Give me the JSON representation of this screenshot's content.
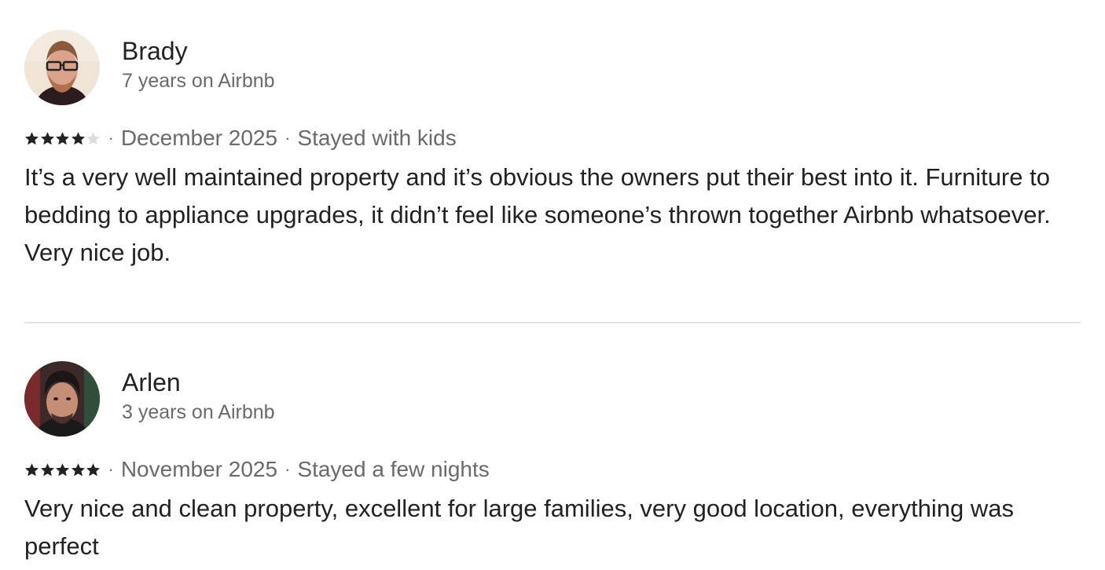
{
  "reviews": [
    {
      "name": "Brady",
      "tenure": "7 years on Airbnb",
      "rating": 4,
      "rating_max": 5,
      "date": "December 2025",
      "trip_type": "Stayed with kids",
      "text": "It’s a very well maintained property and it’s obvious the owners put their best into it. Furniture to bedding to appliance upgrades, it didn’t feel like someone’s thrown together Airbnb whatsoever. Very nice job."
    },
    {
      "name": "Arlen",
      "tenure": "3 years on Airbnb",
      "rating": 5,
      "rating_max": 5,
      "date": "November 2025",
      "trip_type": "Stayed a few nights",
      "text": "Very nice and clean property, excellent for large families, very good location, everything was perfect"
    }
  ],
  "separator": "·",
  "colors": {
    "text_primary": "#222222",
    "text_secondary": "#6a6a6a",
    "star_filled": "#222222",
    "star_empty": "#dddddd",
    "divider": "#e4e4e4"
  }
}
